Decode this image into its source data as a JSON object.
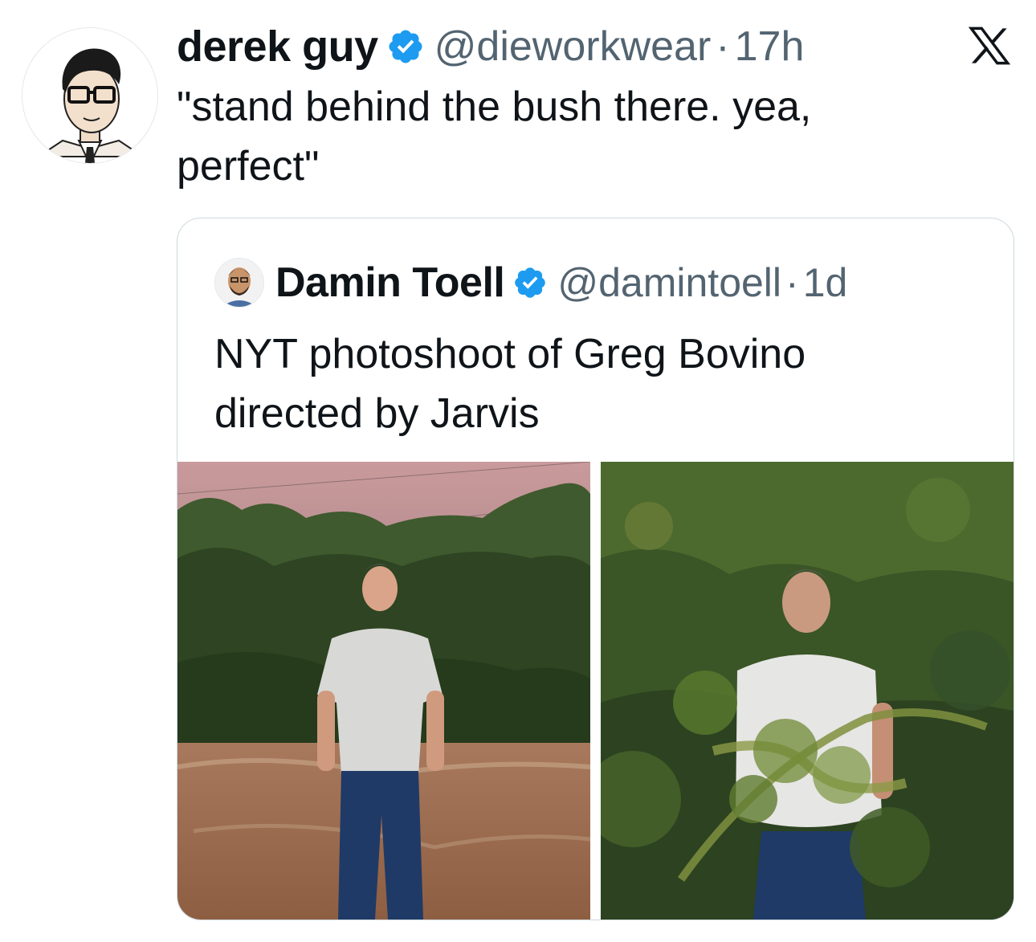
{
  "tweet": {
    "author_name": "derek guy",
    "author_handle": "@dieworkwear",
    "separator": "·",
    "time": "17h",
    "text_line1": "\"stand behind the bush there. yea,",
    "text_line2": "perfect\"",
    "avatar_icon": "illustrated-portrait-avatar",
    "verified_icon": "verified-badge-icon",
    "brand_icon": "x-logo-icon"
  },
  "quote": {
    "author_name": "Damin Toell",
    "author_handle": "@damintoell",
    "separator": "·",
    "time": "1d",
    "text_line1": "NYT photoshoot of Greg Bovino",
    "text_line2": "directed by Jarvis",
    "avatar_icon": "cartoon-avatar",
    "verified_icon": "verified-badge-icon",
    "media": [
      {
        "name": "photo-man-by-bushes",
        "icon": "photo"
      },
      {
        "name": "photo-man-in-bush",
        "icon": "photo"
      }
    ]
  },
  "colors": {
    "text": "#0f1419",
    "secondary": "#536471",
    "verified": "#1d9bf0",
    "border": "#cfd9de"
  }
}
